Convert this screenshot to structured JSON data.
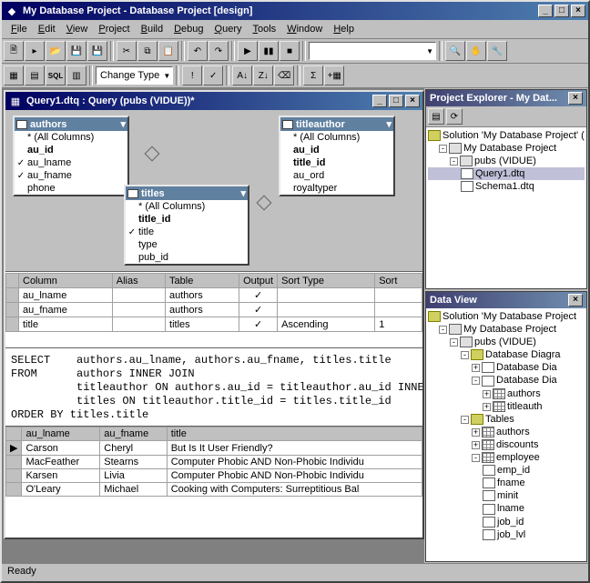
{
  "app": {
    "title": "My Database Project - Database Project [design]",
    "status": "Ready"
  },
  "menus": [
    "File",
    "Edit",
    "View",
    "Project",
    "Build",
    "Debug",
    "Query",
    "Tools",
    "Window",
    "Help"
  ],
  "toolbar2": {
    "change_type": "Change Type"
  },
  "query_window": {
    "title": "Query1.dtq : Query (pubs (VIDUE))*",
    "tables": {
      "authors": {
        "name": "authors",
        "cols": [
          {
            "label": "* (All Columns)",
            "checked": false,
            "bold": false
          },
          {
            "label": "au_id",
            "checked": false,
            "bold": true
          },
          {
            "label": "au_lname",
            "checked": true,
            "bold": false
          },
          {
            "label": "au_fname",
            "checked": true,
            "bold": false
          },
          {
            "label": "phone",
            "checked": false,
            "bold": false
          }
        ]
      },
      "titles": {
        "name": "titles",
        "cols": [
          {
            "label": "* (All Columns)",
            "checked": false,
            "bold": false
          },
          {
            "label": "title_id",
            "checked": false,
            "bold": true
          },
          {
            "label": "title",
            "checked": true,
            "bold": false
          },
          {
            "label": "type",
            "checked": false,
            "bold": false
          },
          {
            "label": "pub_id",
            "checked": false,
            "bold": false
          }
        ]
      },
      "titleauthor": {
        "name": "titleauthor",
        "cols": [
          {
            "label": "* (All Columns)",
            "checked": false,
            "bold": false
          },
          {
            "label": "au_id",
            "checked": false,
            "bold": true
          },
          {
            "label": "title_id",
            "checked": false,
            "bold": true
          },
          {
            "label": "au_ord",
            "checked": false,
            "bold": false
          },
          {
            "label": "royaltyper",
            "checked": false,
            "bold": false
          }
        ]
      }
    },
    "grid": {
      "headers": [
        "Column",
        "Alias",
        "Table",
        "Output",
        "Sort Type",
        "Sort"
      ],
      "rows": [
        {
          "column": "au_lname",
          "alias": "",
          "table": "authors",
          "output": true,
          "sort_type": "",
          "sort": ""
        },
        {
          "column": "au_fname",
          "alias": "",
          "table": "authors",
          "output": true,
          "sort_type": "",
          "sort": ""
        },
        {
          "column": "title",
          "alias": "",
          "table": "titles",
          "output": true,
          "sort_type": "Ascending",
          "sort": "1"
        }
      ]
    },
    "sql": "SELECT    authors.au_lname, authors.au_fname, titles.title\nFROM      authors INNER JOIN\n          titleauthor ON authors.au_id = titleauthor.au_id INNER\n          titles ON titleauthor.title_id = titles.title_id\nORDER BY titles.title",
    "results": {
      "headers": [
        "au_lname",
        "au_fname",
        "title"
      ],
      "rows": [
        {
          "au_lname": "Carson",
          "au_fname": "Cheryl",
          "title": "But Is It User Friendly?"
        },
        {
          "au_lname": "MacFeather",
          "au_fname": "Stearns",
          "title": "Computer Phobic AND Non-Phobic Individu"
        },
        {
          "au_lname": "Karsen",
          "au_fname": "Livia",
          "title": "Computer Phobic AND Non-Phobic Individu"
        },
        {
          "au_lname": "O'Leary",
          "au_fname": "Michael",
          "title": "Cooking with Computers: Surreptitious Bal"
        }
      ]
    }
  },
  "project_explorer": {
    "title": "Project Explorer - My Dat...",
    "solution": "Solution 'My Database Project' (",
    "project": "My Database Project",
    "connection": "pubs (VIDUE)",
    "items": [
      "Query1.dtq",
      "Schema1.dtq"
    ]
  },
  "data_view": {
    "title": "Data View",
    "solution": "Solution 'My Database Project",
    "project": "My Database Project",
    "connection": "pubs (VIDUE)",
    "diagrams_folder": "Database Diagra",
    "diagram_item": "Database Dia",
    "diagram_tables": [
      "authors",
      "titleauth"
    ],
    "tables_folder": "Tables",
    "tables": [
      "authors",
      "discounts"
    ],
    "expanded_table": "employee",
    "expanded_cols": [
      "emp_id",
      "fname",
      "minit",
      "lname",
      "job_id",
      "job_lvl"
    ]
  }
}
